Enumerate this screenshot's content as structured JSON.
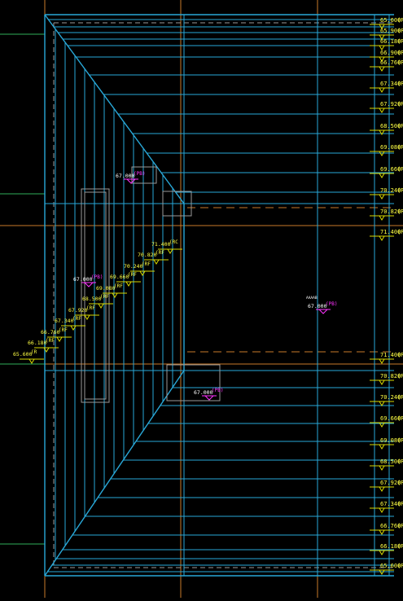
{
  "drawing": {
    "colors": {
      "background": "#000000",
      "roof_lines": "#29a8d8",
      "guide_lines": "#c87a2a",
      "grid_lines": "#2fae5a",
      "dim_text": "#ffff44",
      "dim_marker": "#d8d800",
      "level_text": "#ffffff",
      "tag_text": "#ff33ff",
      "dash_lines": "#9a9a9a"
    },
    "right_labels": [
      {
        "text": "65.600",
        "suffix": "(R"
      },
      {
        "text": "65.900",
        "suffix": "(R"
      },
      {
        "text": "66.180",
        "suffix": "(R"
      },
      {
        "text": "66.900",
        "suffix": "(R"
      },
      {
        "text": "66.760",
        "suffix": "(R"
      },
      {
        "text": "67.340",
        "suffix": "(R"
      },
      {
        "text": "67.920",
        "suffix": "(R"
      },
      {
        "text": "68.500",
        "suffix": "(R"
      },
      {
        "text": "69.080",
        "suffix": "(R"
      },
      {
        "text": "69.660",
        "suffix": "(R"
      },
      {
        "text": "70.240",
        "suffix": "(R"
      },
      {
        "text": "70.820",
        "suffix": "(R"
      },
      {
        "text": "71.400",
        "suffix": "(R"
      },
      {
        "text": "71.400",
        "suffix": "(R"
      },
      {
        "text": "70.820",
        "suffix": "(R"
      },
      {
        "text": "70.240",
        "suffix": "(R"
      },
      {
        "text": "69.660",
        "suffix": "(R"
      },
      {
        "text": "69.080",
        "suffix": "(R"
      },
      {
        "text": "68.500",
        "suffix": "(R"
      },
      {
        "text": "67.920",
        "suffix": "(R"
      },
      {
        "text": "67.340",
        "suffix": "(R"
      },
      {
        "text": "66.760",
        "suffix": "(R"
      },
      {
        "text": "66.180",
        "suffix": "(R"
      },
      {
        "text": "65.600",
        "suffix": "(R"
      }
    ],
    "step_labels": [
      {
        "text": "65.600",
        "suffix": "(R"
      },
      {
        "text": "66.180",
        "suffix": "(RF"
      },
      {
        "text": "66.760",
        "suffix": "(RF"
      },
      {
        "text": "67.340",
        "suffix": "(RF"
      },
      {
        "text": "67.920",
        "suffix": "(RF"
      },
      {
        "text": "68.500",
        "suffix": "(RF"
      },
      {
        "text": "69.080",
        "suffix": "(RF"
      },
      {
        "text": "69.660",
        "suffix": "(RF"
      },
      {
        "text": "70.240",
        "suffix": "(RF"
      },
      {
        "text": "70.820",
        "suffix": "(RF"
      },
      {
        "text": "71.400",
        "suffix": "(RC"
      }
    ],
    "level_markers": [
      {
        "text": "67.000",
        "tag": "(PB)"
      },
      {
        "text": "67.000",
        "tag": "(PB)"
      },
      {
        "text": "67.000",
        "tag": "(PB)"
      },
      {
        "text": "67.000",
        "tag": "(PB)"
      }
    ],
    "small_note": "AAAAB"
  }
}
